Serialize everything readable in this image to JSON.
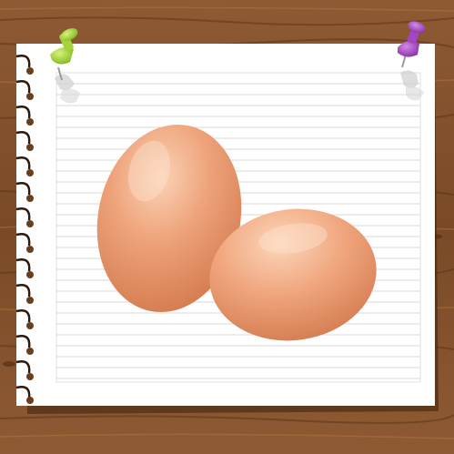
{
  "scene": {
    "description_items": [
      "wood-background",
      "spiral-notebook-page",
      "green-push-pin",
      "purple-push-pin",
      "brown-eggs"
    ]
  },
  "colors": {
    "wood_dark": "#6b3f1f",
    "wood_mid": "#8a5630",
    "wood_light": "#a46a3b",
    "paper": "#ffffff",
    "paper_shadow": "#4a2a12",
    "rule_line": "#d4d4d4",
    "egg_base": "#e9986d",
    "egg_light": "#f7c7a8",
    "egg_shadow": "#c9704a",
    "pin_green": "#9acd32",
    "pin_purple": "#9b3fb7"
  },
  "eggs": {
    "count": 2
  },
  "pins": [
    {
      "name": "green-push-pin",
      "color": "#9acd32"
    },
    {
      "name": "purple-push-pin",
      "color": "#9b3fb7"
    }
  ]
}
